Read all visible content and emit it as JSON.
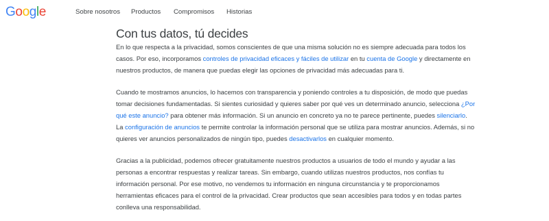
{
  "brand": {
    "logo_letters": [
      {
        "char": "G",
        "color": "#4285F4"
      },
      {
        "char": "o",
        "color": "#EA4335"
      },
      {
        "char": "o",
        "color": "#FBBC05"
      },
      {
        "char": "g",
        "color": "#4285F4"
      },
      {
        "char": "l",
        "color": "#34A853"
      },
      {
        "char": "e",
        "color": "#EA4335"
      }
    ]
  },
  "nav": {
    "items": [
      {
        "label": "Sobre nosotros"
      },
      {
        "label": "Productos"
      },
      {
        "label": "Compromisos"
      },
      {
        "label": "Historias"
      }
    ]
  },
  "main": {
    "heading": "Con tus datos, tú decides",
    "p1": {
      "t1": "En lo que respecta a la privacidad, somos conscientes de que una misma solución no es siempre adecuada para todos los casos. Por eso, incorporamos ",
      "link1": "controles de privacidad eficaces y fáciles de utilizar",
      "t2": " en tu ",
      "link2": "cuenta de Google",
      "t3": " y directamente en nuestros productos, de manera que puedas elegir las opciones de privacidad más adecuadas para ti."
    },
    "p2": {
      "t1": "Cuando te mostramos anuncios, lo hacemos con transparencia y poniendo controles a tu disposición, de modo que puedas tomar decisiones fundamentadas. Si sientes curiosidad y quieres saber por qué ves un determinado anuncio, selecciona ",
      "link1": "¿Por qué este anuncio?",
      "t2": " para obtener más información. Si un anuncio en concreto ya no te parece pertinente, puedes ",
      "link2": "silenciarlo",
      "t3": ". La ",
      "link3": "configuración de anuncios",
      "t4": " te permite controlar la información personal que se utiliza para mostrar anuncios. Además, si no quieres ver anuncios personalizados de ningún tipo, puedes ",
      "link4": "desactivarlos",
      "t5": " en cualquier momento."
    },
    "p3": {
      "text": "Gracias a la publicidad, podemos ofrecer gratuitamente nuestros productos a usuarios de todo el mundo y ayudar a las personas a encontrar respuestas y realizar tareas. Sin embargo, cuando utilizas nuestros productos, nos confías tu información personal. Por ese motivo, no vendemos tu información en ninguna circunstancia y te proporcionamos herramientas eficaces para el control de la privacidad. Crear productos que sean accesibles para todos y en todas partes conlleva una responsabilidad."
    }
  },
  "colors": {
    "text": "#3c4043",
    "link": "#1a73e8",
    "background": "#ffffff"
  }
}
